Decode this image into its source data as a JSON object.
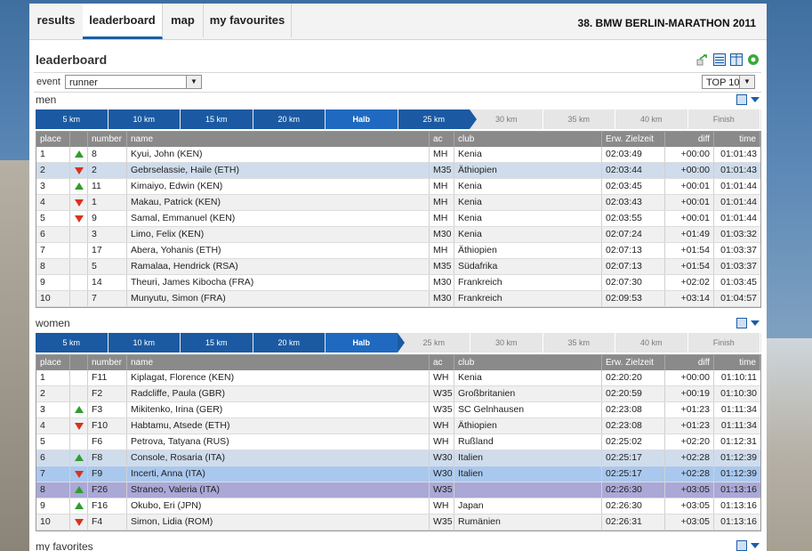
{
  "nav": {
    "tabs": [
      {
        "label": "results"
      },
      {
        "label": "leaderboard"
      },
      {
        "label": "map"
      },
      {
        "label": "my favourites"
      }
    ],
    "event_title": "38. BMW BERLIN-MARATHON 2011"
  },
  "page_title": "leaderboard",
  "event_filter": {
    "label": "event",
    "value": "runner",
    "top_select": "TOP 10"
  },
  "splits": [
    "5 km",
    "10 km",
    "15 km",
    "20 km",
    "Halb",
    "25 km",
    "30 km",
    "35 km",
    "40 km",
    "Finish"
  ],
  "columns": {
    "place": "place",
    "number": "number",
    "name": "name",
    "ac": "ac",
    "club": "club",
    "erw": "Erw. Zielzeit",
    "diff": "diff",
    "time": "time"
  },
  "men": {
    "title": "men",
    "current_split": "25 km",
    "rows": [
      {
        "place": "1",
        "trend": "up",
        "number": "8",
        "name": "Kyui, John (KEN)",
        "ac": "MH",
        "club": "Kenia",
        "erw": "02:03:49",
        "diff": "+00:00",
        "time": "01:01:43"
      },
      {
        "place": "2",
        "trend": "down",
        "number": "2",
        "name": "Gebrselassie, Haile (ETH)",
        "ac": "M35",
        "club": "Äthiopien",
        "erw": "02:03:44",
        "diff": "+00:00",
        "time": "01:01:43"
      },
      {
        "place": "3",
        "trend": "up",
        "number": "11",
        "name": "Kimaiyo, Edwin (KEN)",
        "ac": "MH",
        "club": "Kenia",
        "erw": "02:03:45",
        "diff": "+00:01",
        "time": "01:01:44"
      },
      {
        "place": "4",
        "trend": "down",
        "number": "1",
        "name": "Makau, Patrick (KEN)",
        "ac": "MH",
        "club": "Kenia",
        "erw": "02:03:43",
        "diff": "+00:01",
        "time": "01:01:44"
      },
      {
        "place": "5",
        "trend": "down",
        "number": "9",
        "name": "Samal, Emmanuel (KEN)",
        "ac": "MH",
        "club": "Kenia",
        "erw": "02:03:55",
        "diff": "+00:01",
        "time": "01:01:44"
      },
      {
        "place": "6",
        "trend": "",
        "number": "3",
        "name": "Limo, Felix (KEN)",
        "ac": "M30",
        "club": "Kenia",
        "erw": "02:07:24",
        "diff": "+01:49",
        "time": "01:03:32"
      },
      {
        "place": "7",
        "trend": "",
        "number": "17",
        "name": "Abera, Yohanis (ETH)",
        "ac": "MH",
        "club": "Äthiopien",
        "erw": "02:07:13",
        "diff": "+01:54",
        "time": "01:03:37"
      },
      {
        "place": "8",
        "trend": "",
        "number": "5",
        "name": "Ramalaa, Hendrick (RSA)",
        "ac": "M35",
        "club": "Südafrika",
        "erw": "02:07:13",
        "diff": "+01:54",
        "time": "01:03:37"
      },
      {
        "place": "9",
        "trend": "",
        "number": "14",
        "name": "Theuri, James Kibocha (FRA)",
        "ac": "M30",
        "club": "Frankreich",
        "erw": "02:07:30",
        "diff": "+02:02",
        "time": "01:03:45"
      },
      {
        "place": "10",
        "trend": "",
        "number": "7",
        "name": "Munyutu, Simon (FRA)",
        "ac": "M30",
        "club": "Frankreich",
        "erw": "02:09:53",
        "diff": "+03:14",
        "time": "01:04:57"
      }
    ]
  },
  "women": {
    "title": "women",
    "current_split": "Halb",
    "rows": [
      {
        "place": "1",
        "trend": "",
        "number": "F11",
        "name": "Kiplagat, Florence (KEN)",
        "ac": "WH",
        "club": "Kenia",
        "erw": "02:20:20",
        "diff": "+00:00",
        "time": "01:10:11"
      },
      {
        "place": "2",
        "trend": "",
        "number": "F2",
        "name": "Radcliffe, Paula (GBR)",
        "ac": "W35",
        "club": "Großbritanien",
        "erw": "02:20:59",
        "diff": "+00:19",
        "time": "01:10:30"
      },
      {
        "place": "3",
        "trend": "up",
        "number": "F3",
        "name": "Mikitenko, Irina (GER)",
        "ac": "W35",
        "club": "SC Gelnhausen",
        "erw": "02:23:08",
        "diff": "+01:23",
        "time": "01:11:34"
      },
      {
        "place": "4",
        "trend": "down",
        "number": "F10",
        "name": "Habtamu, Atsede (ETH)",
        "ac": "WH",
        "club": "Äthiopien",
        "erw": "02:23:08",
        "diff": "+01:23",
        "time": "01:11:34"
      },
      {
        "place": "5",
        "trend": "",
        "number": "F6",
        "name": "Petrova, Tatyana (RUS)",
        "ac": "WH",
        "club": "Rußland",
        "erw": "02:25:02",
        "diff": "+02:20",
        "time": "01:12:31"
      },
      {
        "place": "6",
        "trend": "up",
        "number": "F8",
        "name": "Console, Rosaria (ITA)",
        "ac": "W30",
        "club": "Italien",
        "erw": "02:25:17",
        "diff": "+02:28",
        "time": "01:12:39"
      },
      {
        "place": "7",
        "trend": "down",
        "number": "F9",
        "name": "Incerti, Anna (ITA)",
        "ac": "W30",
        "club": "Italien",
        "erw": "02:25:17",
        "diff": "+02:28",
        "time": "01:12:39"
      },
      {
        "place": "8",
        "trend": "up",
        "number": "F26",
        "name": "Straneo, Valeria (ITA)",
        "ac": "W35",
        "club": "",
        "erw": "02:26:30",
        "diff": "+03:05",
        "time": "01:13:16"
      },
      {
        "place": "9",
        "trend": "up",
        "number": "F16",
        "name": "Okubo, Eri (JPN)",
        "ac": "WH",
        "club": "Japan",
        "erw": "02:26:30",
        "diff": "+03:05",
        "time": "01:13:16"
      },
      {
        "place": "10",
        "trend": "down",
        "number": "F4",
        "name": "Simon, Lidia (ROM)",
        "ac": "W35",
        "club": "Rumänien",
        "erw": "02:26:31",
        "diff": "+03:05",
        "time": "01:13:16"
      }
    ]
  },
  "favorites_title": "my favorites",
  "icons": [
    "compare-icon",
    "list-view-icon",
    "column-view-icon",
    "settings-gear-icon",
    "add-to-favorites-icon",
    "expand-arrow-icon"
  ],
  "colors": {
    "accent": "#1b5aa2",
    "header_gray": "#8a8a8a",
    "up": "#2e9e2e",
    "down": "#d8321e",
    "highlight_1": "#cfdcec",
    "highlight_2": "#a9c8ee",
    "highlight_3": "#aaa8d6"
  }
}
